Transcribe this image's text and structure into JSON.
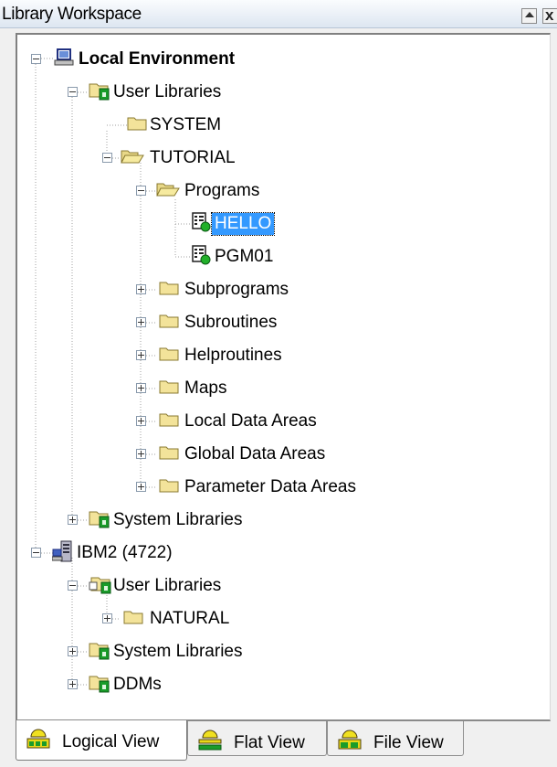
{
  "window": {
    "title": "Library Workspace",
    "minimize_icon": "triangle-up",
    "close_label": "x"
  },
  "tree": {
    "local_environment": "Local Environment",
    "user_libraries": "User Libraries",
    "system": "SYSTEM",
    "tutorial": "TUTORIAL",
    "programs": "Programs",
    "hello": "HELLO",
    "pgm01": "PGM01",
    "subprograms": "Subprograms",
    "subroutines": "Subroutines",
    "helproutines": "Helproutines",
    "maps": "Maps",
    "local_data_areas": "Local Data Areas",
    "global_data_areas": "Global Data Areas",
    "parameter_data_areas": "Parameter Data Areas",
    "system_libraries": "System Libraries",
    "ibm2": "IBM2 (4722)",
    "ibm2_user_libraries": "User Libraries",
    "natural": "NATURAL",
    "ibm2_system_libraries": "System Libraries",
    "ddms": "DDMs",
    "selected_item": "HELLO"
  },
  "tabs": {
    "logical_view": "Logical View",
    "flat_view": "Flat View",
    "file_view": "File View",
    "active": "Logical View"
  },
  "colors": {
    "selection": "#3399ff",
    "folder": "#f3e39a",
    "library_green": "#1a9c2a"
  }
}
